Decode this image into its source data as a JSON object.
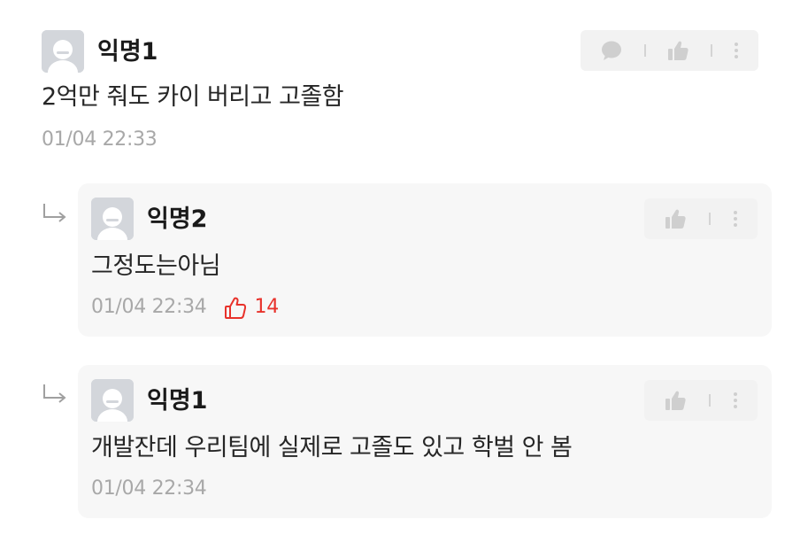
{
  "comments": [
    {
      "author": "익명1",
      "text": "2억만 줘도 카이 버리고 고졸함",
      "time": "01/04 22:33"
    }
  ],
  "replies": [
    {
      "author": "익명2",
      "text": "그정도는아님",
      "time": "01/04 22:34",
      "likes": "14"
    },
    {
      "author": "익명1",
      "text": "개발잔데 우리팀에 실제로 고졸도 있고 학벌 안 봄",
      "time": "01/04 22:34"
    }
  ],
  "icons": {
    "comment": "speech-bubble-icon",
    "like": "thumbs-up-icon",
    "more": "vertical-dots-icon",
    "reply": "reply-arrow-icon",
    "avatar": "default-avatar-icon"
  },
  "colors": {
    "like_accent": "#e8322b",
    "meta": "#a8a8a8",
    "reply_bg": "#f7f7f7",
    "action_bg": "#f2f2f2"
  }
}
